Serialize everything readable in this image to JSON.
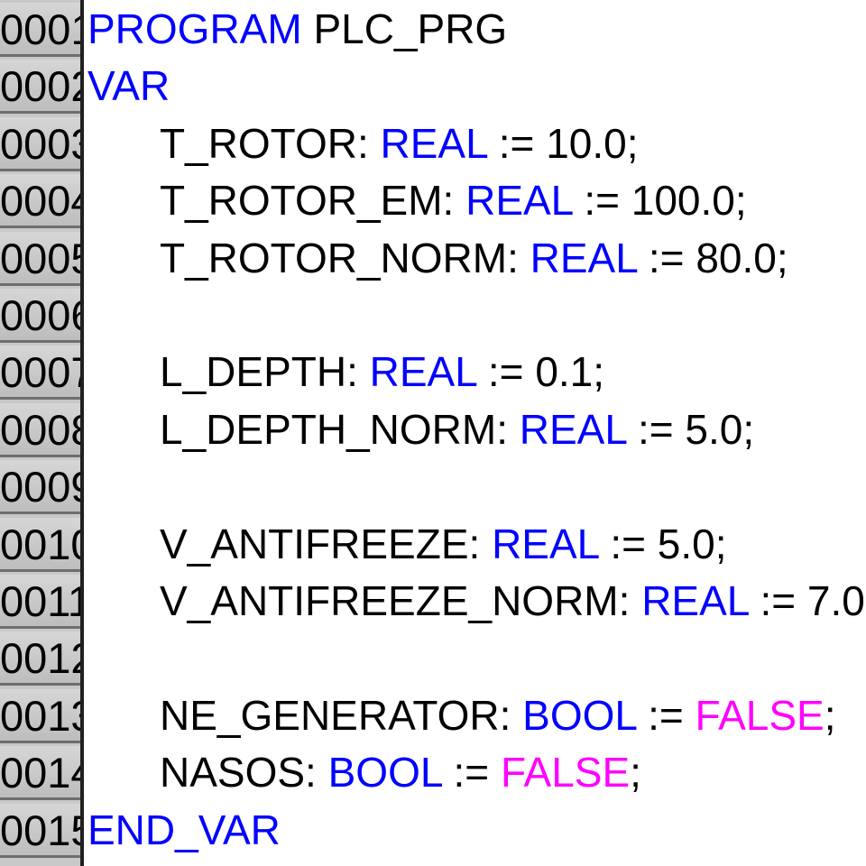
{
  "line_numbers": [
    "0001",
    "0002",
    "0003",
    "0004",
    "0005",
    "0006",
    "0007",
    "0008",
    "0009",
    "0010",
    "0011",
    "0012",
    "0013",
    "0014",
    "0015"
  ],
  "code": {
    "l1": {
      "kw": "PROGRAM",
      "name": " PLC_PRG"
    },
    "l2": {
      "kw": "VAR"
    },
    "l3": {
      "ident": "T_ROTOR: ",
      "type": "REAL",
      "rest": " := 10.0;"
    },
    "l4": {
      "ident": "T_ROTOR_EM: ",
      "type": "REAL",
      "rest": " := 100.0;"
    },
    "l5": {
      "ident": "T_ROTOR_NORM: ",
      "type": "REAL",
      "rest": " := 80.0;"
    },
    "l7": {
      "ident": "L_DEPTH: ",
      "type": "REAL",
      "rest": " := 0.1;"
    },
    "l8": {
      "ident": "L_DEPTH_NORM: ",
      "type": "REAL",
      "rest": " := 5.0;"
    },
    "l10": {
      "ident": "V_ANTIFREEZE: ",
      "type": "REAL",
      "rest": " := 5.0;"
    },
    "l11": {
      "ident": "V_ANTIFREEZE_NORM: ",
      "type": "REAL",
      "rest": " := 7.0"
    },
    "l13": {
      "ident": "NE_GENERATOR: ",
      "type": "BOOL",
      "op": " := ",
      "value": "FALSE",
      "end": ";"
    },
    "l14": {
      "ident": "NASOS: ",
      "type": "BOOL",
      "op": " := ",
      "value": "FALSE",
      "end": ";"
    },
    "l15": {
      "kw": "END_VAR"
    }
  },
  "colors": {
    "keyword": "#0000ff",
    "literal": "#ff00ff",
    "text": "#000000",
    "gutter": "#c8c8c8"
  }
}
